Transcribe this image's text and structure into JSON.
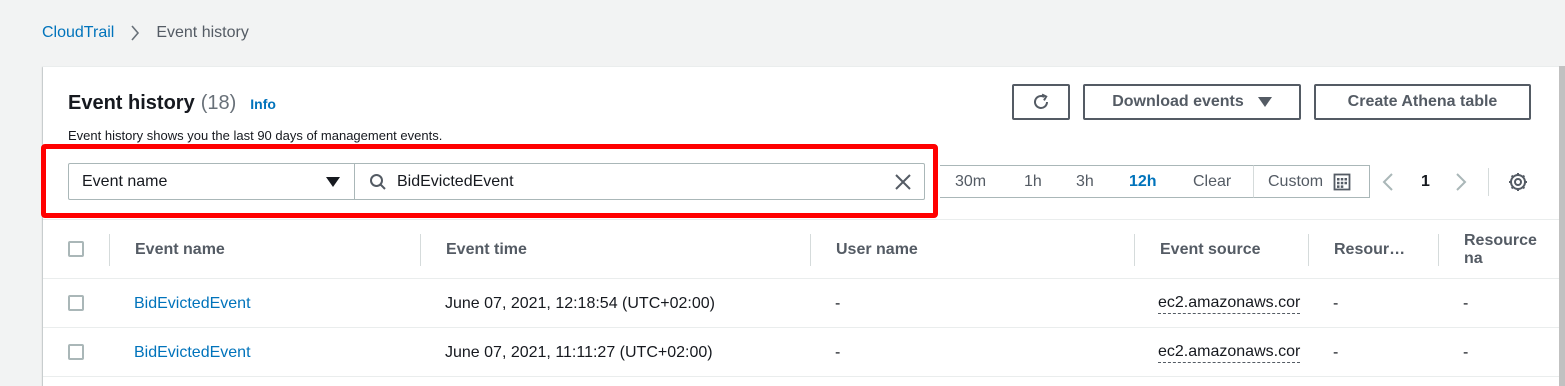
{
  "breadcrumb": {
    "root": "CloudTrail",
    "current": "Event history"
  },
  "header": {
    "title": "Event history",
    "count": "(18)",
    "info": "Info",
    "description": "Event history shows you the last 90 days of management events."
  },
  "actions": {
    "refresh_icon": "refresh-icon",
    "download": "Download events",
    "athena": "Create Athena table"
  },
  "filter": {
    "attribute": "Event name",
    "value": "BidEvictedEvent"
  },
  "time_range": {
    "options": [
      "30m",
      "1h",
      "3h",
      "12h",
      "Clear"
    ],
    "selected": "12h",
    "custom": "Custom"
  },
  "pagination": {
    "page": "1"
  },
  "table": {
    "columns": [
      "Event name",
      "Event time",
      "User name",
      "Event source",
      "Resour…",
      "Resource na"
    ],
    "rows": [
      {
        "event_name": "BidEvictedEvent",
        "event_time": "June 07, 2021, 12:18:54 (UTC+02:00)",
        "user_name": "-",
        "event_source": "ec2.amazonaws.cor",
        "resource_type": "-",
        "resource_name": "-"
      },
      {
        "event_name": "BidEvictedEvent",
        "event_time": "June 07, 2021, 11:11:27 (UTC+02:00)",
        "user_name": "-",
        "event_source": "ec2.amazonaws.cor",
        "resource_type": "-",
        "resource_name": "-"
      }
    ]
  },
  "colors": {
    "link": "#0073bb",
    "highlight": "#ff0000",
    "text": "#16191f",
    "muted": "#545b64"
  }
}
